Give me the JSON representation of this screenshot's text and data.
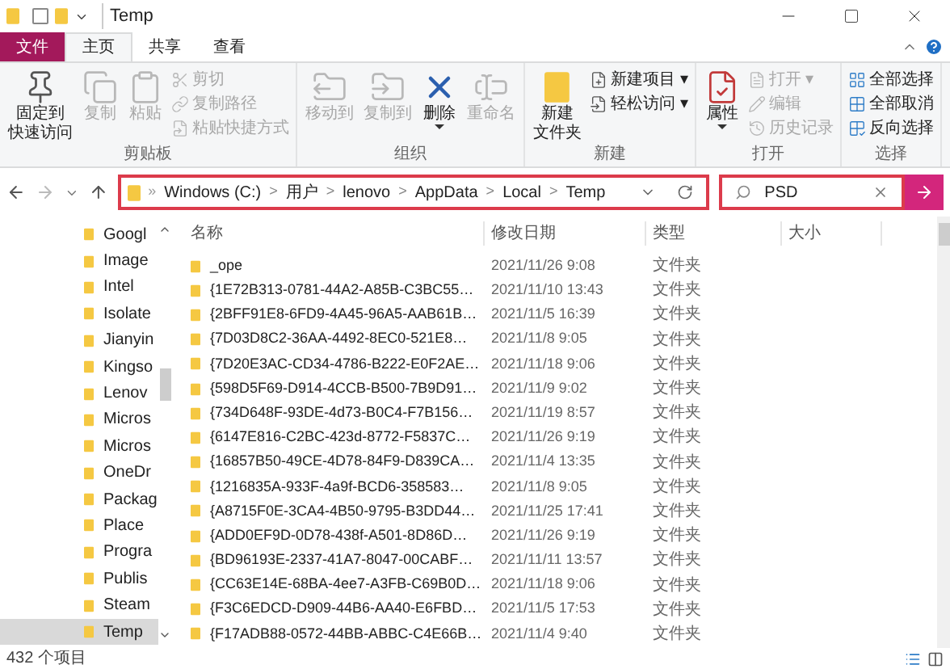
{
  "window": {
    "title": "Temp"
  },
  "tabs": [
    {
      "label": "文件",
      "kind": "file",
      "selected": false
    },
    {
      "label": "主页",
      "kind": "tab",
      "selected": true
    },
    {
      "label": "共享",
      "kind": "tab",
      "selected": false
    },
    {
      "label": "查看",
      "kind": "tab",
      "selected": false
    }
  ],
  "ribbon": {
    "groups": [
      {
        "label": "剪贴板",
        "items": [
          {
            "kind": "large",
            "lines": [
              "固定到",
              "快速访问"
            ],
            "disabled": false
          },
          {
            "kind": "large",
            "lines": [
              "复制"
            ],
            "disabled": true
          },
          {
            "kind": "large",
            "lines": [
              "粘贴"
            ],
            "disabled": true
          },
          {
            "kind": "stack",
            "entries": [
              {
                "label": "剪切",
                "disabled": true
              },
              {
                "label": "复制路径",
                "disabled": true
              },
              {
                "label": "粘贴快捷方式",
                "disabled": true
              }
            ]
          }
        ]
      },
      {
        "label": "组织",
        "items": [
          {
            "kind": "large",
            "lines": [
              "移动到"
            ],
            "disabled": true
          },
          {
            "kind": "large",
            "lines": [
              "复制到"
            ],
            "disabled": true
          },
          {
            "kind": "large",
            "lines": [
              "删除"
            ],
            "disabled": false,
            "dropdown": true
          },
          {
            "kind": "large",
            "lines": [
              "重命名"
            ],
            "disabled": true
          }
        ]
      },
      {
        "label": "新建",
        "items": [
          {
            "kind": "large",
            "lines": [
              "新建",
              "文件夹"
            ],
            "disabled": false
          },
          {
            "kind": "stack",
            "entries": [
              {
                "label": "新建项目 ▾",
                "disabled": false
              },
              {
                "label": "轻松访问 ▾",
                "disabled": false
              }
            ]
          }
        ]
      },
      {
        "label": "打开",
        "items": [
          {
            "kind": "large",
            "lines": [
              "属性"
            ],
            "disabled": false,
            "dropdown": true
          },
          {
            "kind": "stack",
            "entries": [
              {
                "label": "打开 ▾",
                "disabled": true
              },
              {
                "label": "编辑",
                "disabled": true
              },
              {
                "label": "历史记录",
                "disabled": true
              }
            ]
          }
        ]
      },
      {
        "label": "选择",
        "items": [
          {
            "kind": "stack",
            "entries": [
              {
                "label": "全部选择",
                "disabled": false
              },
              {
                "label": "全部取消",
                "disabled": false
              },
              {
                "label": "反向选择",
                "disabled": false
              }
            ]
          }
        ]
      }
    ]
  },
  "address_bar": {
    "highlighted": true,
    "overflow": "»",
    "crumbs": [
      "Windows (C:)",
      "用户",
      "lenovo",
      "AppData",
      "Local",
      "Temp"
    ],
    "separator": ">"
  },
  "search": {
    "highlighted": true,
    "value": "PSD"
  },
  "nav_pane": {
    "items": [
      {
        "label": "Googl",
        "selected": false
      },
      {
        "label": "Image",
        "selected": false
      },
      {
        "label": "Intel",
        "selected": false
      },
      {
        "label": "Isolate",
        "selected": false
      },
      {
        "label": "Jianyin",
        "selected": false
      },
      {
        "label": "Kingso",
        "selected": false
      },
      {
        "label": "Lenov",
        "selected": false
      },
      {
        "label": "Micros",
        "selected": false
      },
      {
        "label": "Micros",
        "selected": false
      },
      {
        "label": "OneDr",
        "selected": false
      },
      {
        "label": "Packag",
        "selected": false
      },
      {
        "label": "Place",
        "selected": false
      },
      {
        "label": "Progra",
        "selected": false
      },
      {
        "label": "Publis",
        "selected": false
      },
      {
        "label": "Steam",
        "selected": false
      },
      {
        "label": "Temp",
        "selected": true
      }
    ]
  },
  "table": {
    "columns": [
      "名称",
      "修改日期",
      "类型",
      "大小"
    ],
    "rows": [
      {
        "name": "_ope",
        "modified": "2021/11/26 9:08",
        "type": "文件夹"
      },
      {
        "name": "{1E72B313-0781-44A2-A85B-C3BC55…",
        "modified": "2021/11/10 13:43",
        "type": "文件夹"
      },
      {
        "name": "{2BFF91E8-6FD9-4A45-96A5-AAB61B…",
        "modified": "2021/11/5 16:39",
        "type": "文件夹"
      },
      {
        "name": "{7D03D8C2-36AA-4492-8EC0-521E8…",
        "modified": "2021/11/8 9:05",
        "type": "文件夹"
      },
      {
        "name": "{7D20E3AC-CD34-4786-B222-E0F2AE…",
        "modified": "2021/11/18 9:06",
        "type": "文件夹"
      },
      {
        "name": "{598D5F69-D914-4CCB-B500-7B9D91…",
        "modified": "2021/11/9 9:02",
        "type": "文件夹"
      },
      {
        "name": "{734D648F-93DE-4d73-B0C4-F7B156…",
        "modified": "2021/11/19 8:57",
        "type": "文件夹"
      },
      {
        "name": "{6147E816-C2BC-423d-8772-F5837C…",
        "modified": "2021/11/26 9:19",
        "type": "文件夹"
      },
      {
        "name": "{16857B50-49CE-4D78-84F9-D839CA…",
        "modified": "2021/11/4 13:35",
        "type": "文件夹"
      },
      {
        "name": "{1216835A-933F-4a9f-BCD6-358583…",
        "modified": "2021/11/8 9:05",
        "type": "文件夹"
      },
      {
        "name": "{A8715F0E-3CA4-4B50-9795-B3DD44…",
        "modified": "2021/11/25 17:41",
        "type": "文件夹"
      },
      {
        "name": "{ADD0EF9D-0D78-438f-A501-8D86D…",
        "modified": "2021/11/26 9:19",
        "type": "文件夹"
      },
      {
        "name": "{BD96193E-2337-41A7-8047-00CABF…",
        "modified": "2021/11/11 13:57",
        "type": "文件夹"
      },
      {
        "name": "{CC63E14E-68BA-4ee7-A3FB-C69B0D…",
        "modified": "2021/11/18 9:06",
        "type": "文件夹"
      },
      {
        "name": "{F3C6EDCD-D909-44B6-AA40-E6FBD…",
        "modified": "2021/11/5 17:53",
        "type": "文件夹"
      },
      {
        "name": "{F17ADB88-0572-44BB-ABBC-C4E66B…",
        "modified": "2021/11/4 9:40",
        "type": "文件夹"
      }
    ]
  },
  "status_bar": {
    "count": "432 个项目"
  }
}
